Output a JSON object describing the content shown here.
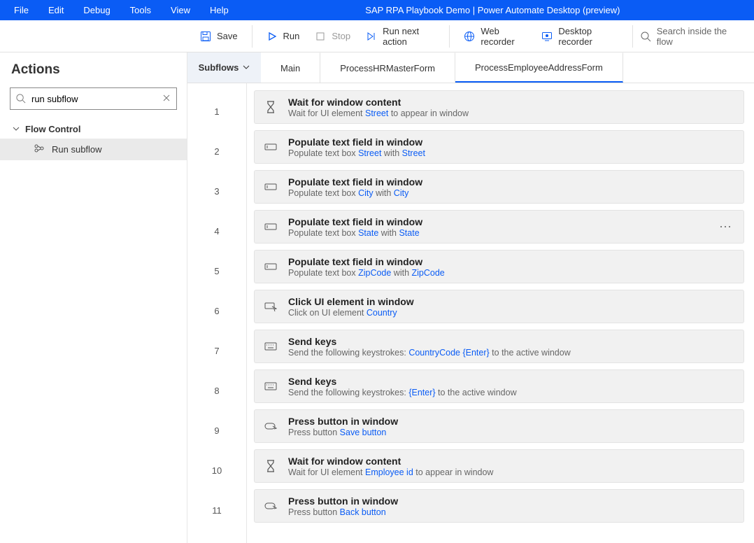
{
  "titlebar": {
    "menus": [
      "File",
      "Edit",
      "Debug",
      "Tools",
      "View",
      "Help"
    ],
    "title": "SAP RPA Playbook Demo | Power Automate Desktop (preview)"
  },
  "toolbar": {
    "save": "Save",
    "run": "Run",
    "stop": "Stop",
    "run_next": "Run next action",
    "web_rec": "Web recorder",
    "desk_rec": "Desktop recorder",
    "search_ph": "Search inside the flow"
  },
  "sidebar": {
    "title": "Actions",
    "search_value": "run subflow",
    "group": "Flow Control",
    "item": "Run subflow"
  },
  "tabs": {
    "subflows": "Subflows",
    "list": [
      "Main",
      "ProcessHRMasterForm",
      "ProcessEmployeeAddressForm"
    ],
    "active": 2
  },
  "steps": [
    {
      "n": "1",
      "icon": "hourglass",
      "title": "Wait for window content",
      "desc": [
        [
          "t",
          "Wait for UI element "
        ],
        [
          "l",
          "Street"
        ],
        [
          "t",
          " to appear in window"
        ]
      ]
    },
    {
      "n": "2",
      "icon": "textbox",
      "title": "Populate text field in window",
      "desc": [
        [
          "t",
          "Populate text box "
        ],
        [
          "l",
          "Street"
        ],
        [
          "t",
          " with   "
        ],
        [
          "l",
          "Street"
        ]
      ]
    },
    {
      "n": "3",
      "icon": "textbox",
      "title": "Populate text field in window",
      "desc": [
        [
          "t",
          "Populate text box "
        ],
        [
          "l",
          "City"
        ],
        [
          "t",
          " with   "
        ],
        [
          "l",
          "City"
        ]
      ]
    },
    {
      "n": "4",
      "icon": "textbox",
      "title": "Populate text field in window",
      "desc": [
        [
          "t",
          "Populate text box "
        ],
        [
          "l",
          "State"
        ],
        [
          "t",
          " with   "
        ],
        [
          "l",
          "State"
        ]
      ],
      "more": true
    },
    {
      "n": "5",
      "icon": "textbox",
      "title": "Populate text field in window",
      "desc": [
        [
          "t",
          "Populate text box "
        ],
        [
          "l",
          "ZipCode"
        ],
        [
          "t",
          " with   "
        ],
        [
          "l",
          "ZipCode"
        ]
      ]
    },
    {
      "n": "6",
      "icon": "click",
      "title": "Click UI element in window",
      "desc": [
        [
          "t",
          "Click on UI element "
        ],
        [
          "l",
          "Country"
        ]
      ]
    },
    {
      "n": "7",
      "icon": "keyboard",
      "title": "Send keys",
      "desc": [
        [
          "t",
          "Send the following keystrokes:   "
        ],
        [
          "l",
          "CountryCode"
        ],
        [
          "t",
          "  "
        ],
        [
          "l",
          "{Enter}"
        ],
        [
          "t",
          " to the active window"
        ]
      ]
    },
    {
      "n": "8",
      "icon": "keyboard",
      "title": "Send keys",
      "desc": [
        [
          "t",
          "Send the following keystrokes: "
        ],
        [
          "l",
          "{Enter}"
        ],
        [
          "t",
          " to the active window"
        ]
      ]
    },
    {
      "n": "9",
      "icon": "button",
      "title": "Press button in window",
      "desc": [
        [
          "t",
          "Press button "
        ],
        [
          "l",
          "Save button"
        ]
      ]
    },
    {
      "n": "10",
      "icon": "hourglass",
      "title": "Wait for window content",
      "desc": [
        [
          "t",
          "Wait for UI element "
        ],
        [
          "l",
          "Employee id"
        ],
        [
          "t",
          " to appear in window"
        ]
      ]
    },
    {
      "n": "11",
      "icon": "button",
      "title": "Press button in window",
      "desc": [
        [
          "t",
          "Press button "
        ],
        [
          "l",
          "Back button"
        ]
      ]
    }
  ]
}
